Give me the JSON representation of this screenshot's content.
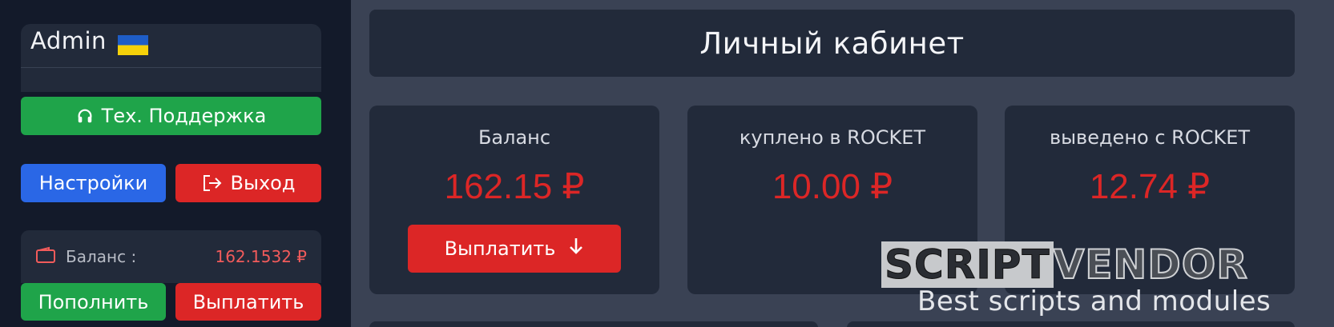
{
  "sidebar": {
    "user": {
      "name": "Admin"
    },
    "support_label": "Тех. Поддержка",
    "settings_label": "Настройки",
    "logout_label": "Выход",
    "balance": {
      "label": "Баланс :",
      "value": "162.1532 ₽"
    },
    "deposit_label": "Пополнить",
    "withdraw_label": "Выплатить"
  },
  "header": {
    "title": "Личный кабинет"
  },
  "stats": [
    {
      "label": "Баланс",
      "value": "162.15 ₽",
      "button": "Выплатить"
    },
    {
      "label": "куплено в ROCKET",
      "value": "10.00 ₽"
    },
    {
      "label": "выведено с ROCKET",
      "value": "12.74 ₽"
    }
  ],
  "watermark": {
    "brand_a": "SCRIPT",
    "brand_b": "VENDOR",
    "tagline": "Best scripts and modules"
  },
  "colors": {
    "accent_red": "#dc2626",
    "accent_green": "#1fa44a",
    "accent_blue": "#2a67e6",
    "panel": "#222a3a",
    "sidebar_bg": "#131a2a",
    "content_bg": "#3a4254"
  },
  "icons": {
    "support": "headset-icon",
    "logout": "logout-icon",
    "wallet": "wallet-icon",
    "payout": "arrow-down-icon",
    "flag": "ukraine-flag-icon"
  }
}
